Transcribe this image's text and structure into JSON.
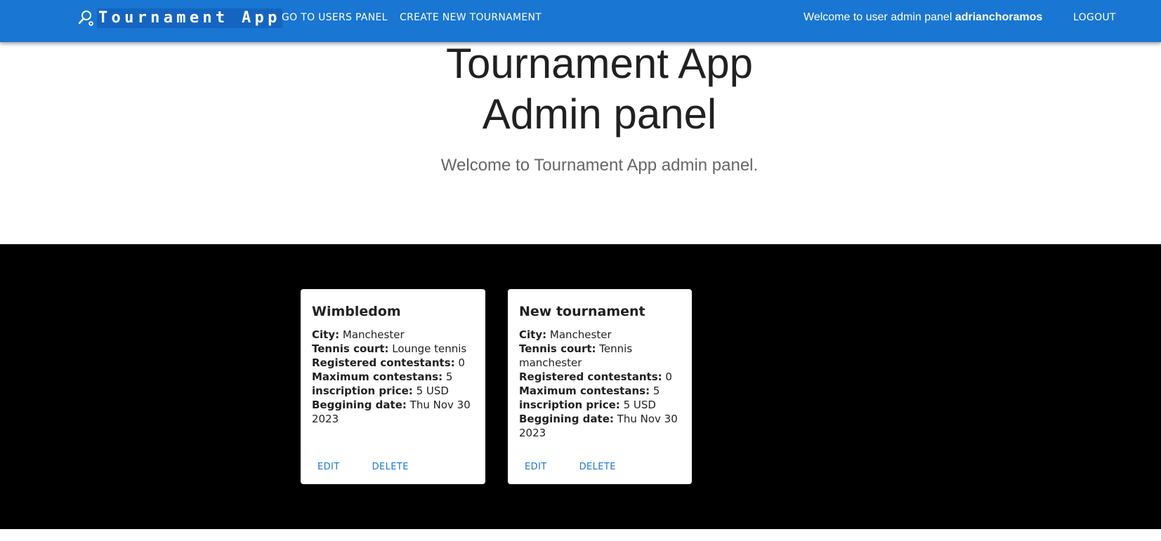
{
  "appbar": {
    "brand_text": "Tournament App",
    "nav": [
      "GO TO USERS PANEL",
      "CREATE NEW TOURNAMENT"
    ],
    "welcome_prefix": "Welcome to user admin panel",
    "username": "adrianchoramos",
    "logout_label": "LOGOUT",
    "brand_icon": "racket-icon",
    "color": "#1976d2"
  },
  "hero": {
    "title_line1": "Tournament App",
    "title_line2": "Admin panel",
    "subtitle": "Welcome to Tournament App admin panel."
  },
  "field_labels": {
    "city": "City:",
    "court": "Tennis court:",
    "registered": "Registered contestants:",
    "maximum": "Maximum contestans:",
    "price": "inscription price:",
    "date": "Beggining date:"
  },
  "tournaments": [
    {
      "name": "Wimbledom",
      "city": "Manchester",
      "court": "Lounge tennis",
      "registered": "0",
      "maximum": "5",
      "price": "5 USD",
      "date": "Thu Nov 30 2023",
      "edit_label": "EDIT",
      "delete_label": "DELETE"
    },
    {
      "name": "New tournament",
      "city": "Manchester",
      "court": "Tennis manchester",
      "registered": "0",
      "maximum": "5",
      "price": "5 USD",
      "date": "Thu Nov 30 2023",
      "edit_label": "EDIT",
      "delete_label": "DELETE"
    }
  ]
}
